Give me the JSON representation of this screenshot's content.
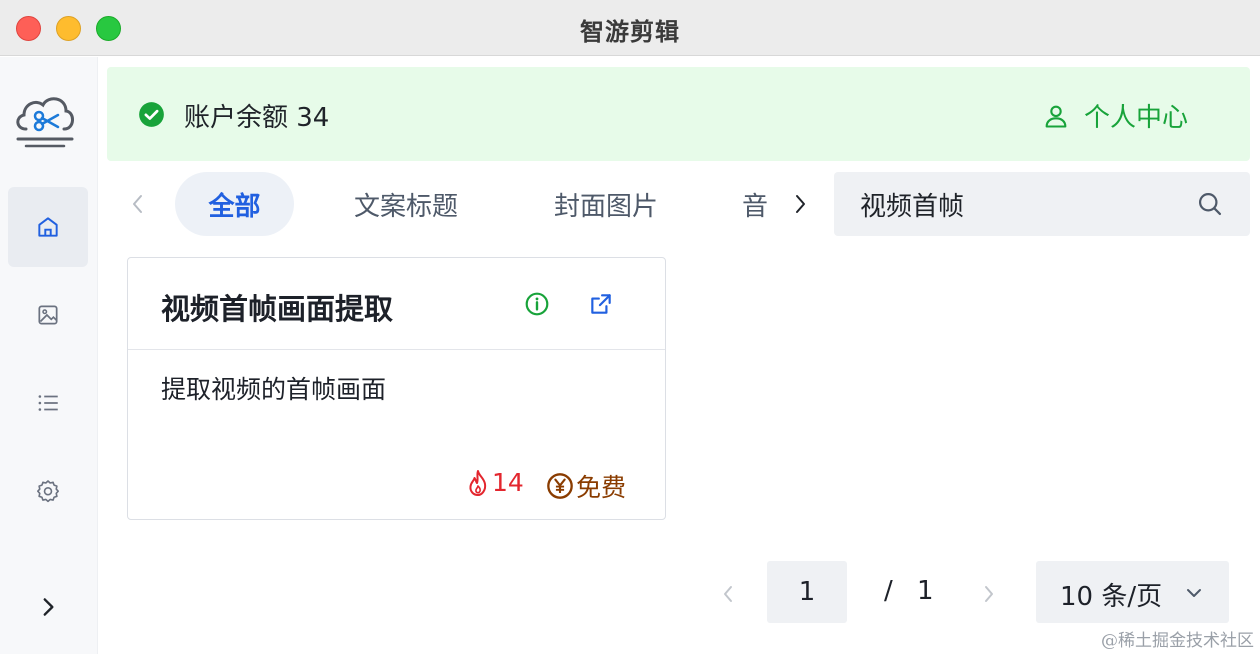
{
  "window": {
    "title": "智游剪辑"
  },
  "sidebar": {
    "items": [
      {
        "icon": "home-icon",
        "active": true
      },
      {
        "icon": "image-icon",
        "active": false
      },
      {
        "icon": "list-icon",
        "active": false
      },
      {
        "icon": "gear-icon",
        "active": false
      }
    ],
    "expand_icon": "chevron-right-icon"
  },
  "banner": {
    "balance_label": "账户余额 34",
    "profile_label": "个人中心"
  },
  "tabs": {
    "items": [
      "全部",
      "文案标题",
      "封面图片",
      "音"
    ],
    "active_index": 0
  },
  "search": {
    "value": "视频首帧"
  },
  "cards": [
    {
      "title": "视频首帧画面提取",
      "description": "提取视频的首帧画面",
      "hot_count": "14",
      "price": "免费"
    }
  ],
  "pagination": {
    "current": "1",
    "separator": "/",
    "total": "1",
    "page_size_label": "10 条/页"
  },
  "watermark": "@稀土掘金技术社区",
  "colors": {
    "accent_green": "#18a33a",
    "accent_blue": "#2160e0",
    "hot_red": "#e3262e",
    "price_brown": "#8a3c00",
    "banner_bg": "#e7fbe9"
  }
}
